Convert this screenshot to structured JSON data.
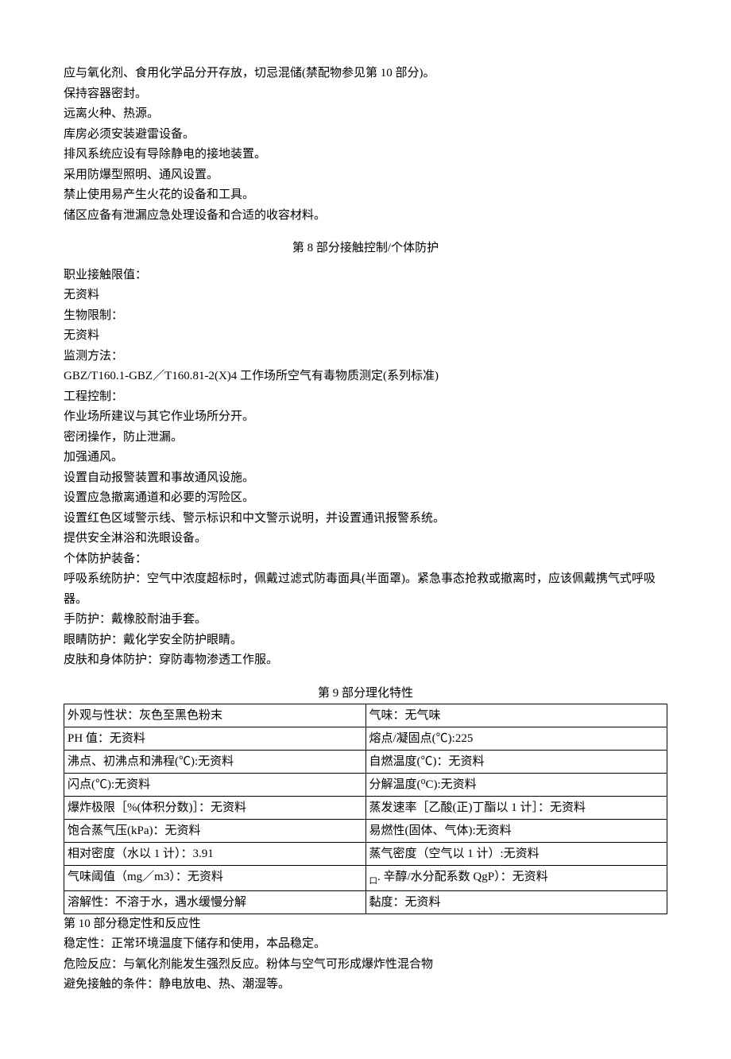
{
  "storage": {
    "p1": "应与氧化剂、食用化学品分开存放，切忌混储(禁配物参见第 10 部分)。",
    "p2": "保持容器密封。",
    "p3": "远离火种、热源。",
    "p4": "库房必须安装避雷设备。",
    "p5": "排风系统应设有导除静电的接地装置。",
    "p6": "采用防爆型照明、通风设置。",
    "p7": "禁止使用易产生火花的设备和工具。",
    "p8": "储区应备有泄漏应急处理设备和合适的收容材料。"
  },
  "section8": {
    "title": "第 8 部分接触控制/个体防护",
    "p1": "职业接触限值：",
    "p2": "无资料",
    "p3": "生物限制：",
    "p4": "无资料",
    "p5": "监测方法：",
    "p6": "GBZ/T160.1-GBZ／T160.81-2(X)4 工作场所空气有毒物质测定(系列标准)",
    "p7": "工程控制：",
    "p8": "作业场所建议与其它作业场所分开。",
    "p9": "密闭操作，防止泄漏。",
    "p10": "加强通风。",
    "p11": "设置自动报警装置和事故通风设施。",
    "p12": "设置应急撤离通道和必要的泻险区。",
    "p13": "设置红色区域警示线、警示标识和中文警示说明，并设置通讯报警系统。",
    "p14": "提供安全淋浴和洗眼设备。",
    "p15": "个体防护装备：",
    "p16": "呼吸系统防护：空气中浓度超标时，佩戴过滤式防毒面具(半面罩)。紧急事态抢救或撤离时，应该佩戴携气式呼吸器。",
    "p17": "手防护：戴橡胶耐油手套。",
    "p18": "眼睛防护：戴化学安全防护眼睛。",
    "p19": "皮肤和身体防护：穿防毒物渗透工作服。"
  },
  "section9": {
    "title": "第 9 部分理化特性",
    "rows": [
      {
        "c1": "外观与性状：灰色至黑色粉末",
        "c2": "气味：无气味"
      },
      {
        "c1": "PH 值：无资料",
        "c2": "熔点/凝固点(℃):225"
      },
      {
        "c1": "沸点、初沸点和沸程(℃):无资料",
        "c2": "自燃温度(℃)：无资料"
      },
      {
        "c1": "闪点(℃):无资料",
        "c2": "分解温度(⁰C):无资料"
      },
      {
        "c1": "爆炸极限［%(体积分数)］：无资料",
        "c2": "蒸发速率［乙酸(正)丁酯以 1 计］：无资料"
      },
      {
        "c1": "饱合蒸气压(kPa)：无资料",
        "c2": "易燃性(固体、气体):无资料"
      },
      {
        "c1": "相对密度（水以 1 计）：3.91",
        "c2": "蒸气密度（空气以 1 计）:无资料"
      },
      {
        "c1": "气味阈值（mg／m3）：无资料",
        "c2": ". 辛醇/水分配系数 QgP）：无资料",
        "prefix": "口"
      },
      {
        "c1": "溶解性：不溶于水，遇水缓慢分解",
        "c2": "黏度：无资料"
      }
    ]
  },
  "section10": {
    "title": "第 10 部分稳定性和反应性",
    "p1": "稳定性：正常环境温度下储存和使用，本品稳定。",
    "p2": "危险反应：与氧化剂能发生强烈反应。粉体与空气可形成爆炸性混合物",
    "p3": "避免接触的条件：静电放电、热、潮湿等。"
  }
}
